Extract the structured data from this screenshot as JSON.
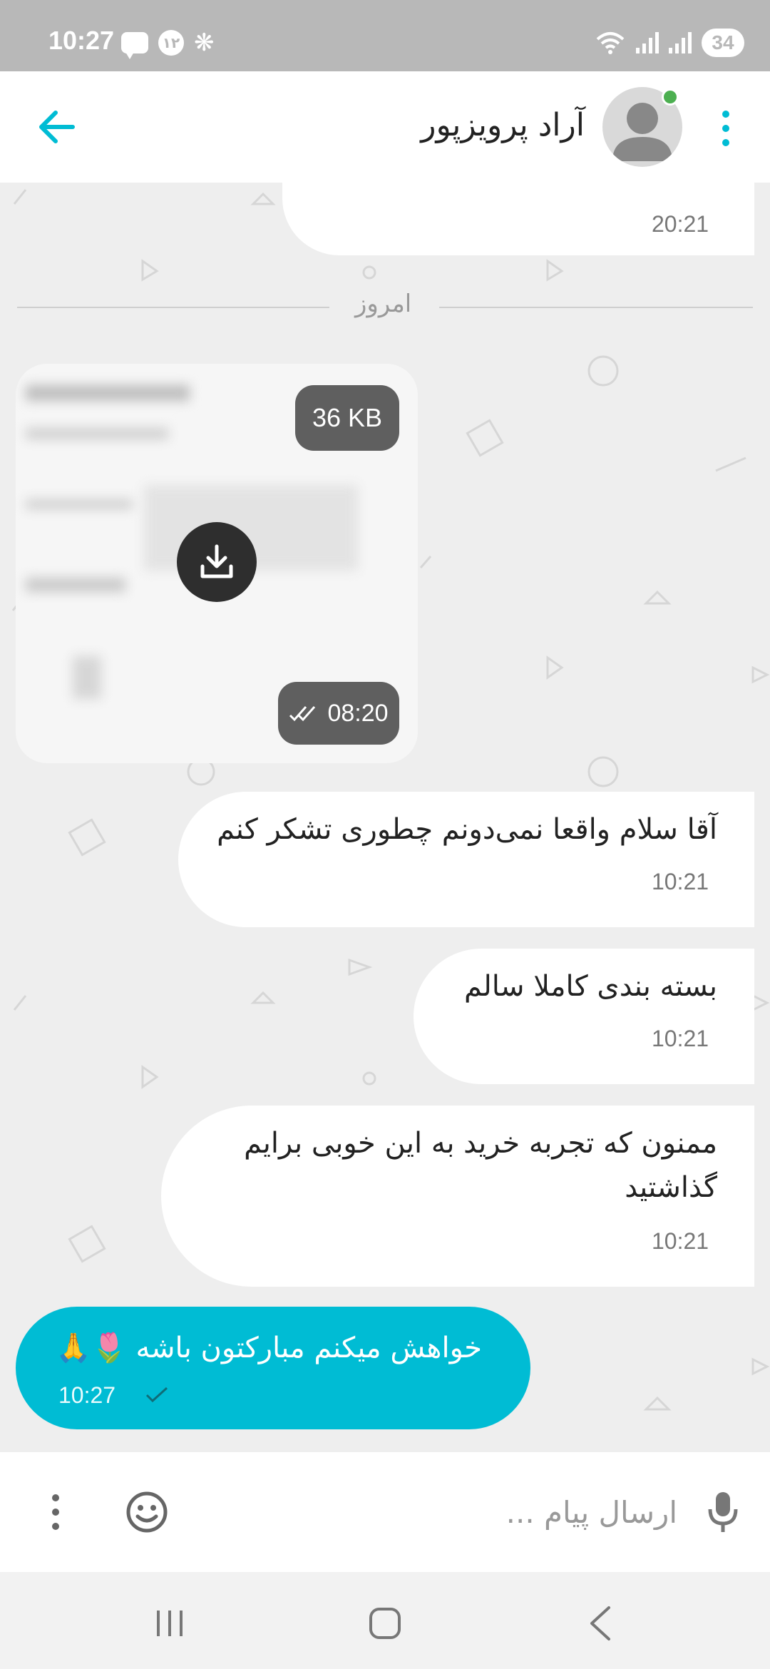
{
  "status_bar": {
    "time": "10:27",
    "notification_badge": "۱۲",
    "battery": "34"
  },
  "header": {
    "title": "آراد پرویزپور"
  },
  "messages": [
    {
      "text": "",
      "time": "20:21"
    },
    {
      "text": "آقا سلام واقعا نمی‌دونم چطوری تشکر کنم",
      "time": "10:21"
    },
    {
      "text": "بسته بندی کاملا سالم",
      "time": "10:21"
    },
    {
      "text": "ممنون که تجربه خرید به این خوبی برایم گذاشتید",
      "time": "10:21"
    }
  ],
  "date_divider": "امروز",
  "attachment": {
    "size": "36 KB",
    "time": "08:20"
  },
  "sent_message": {
    "text": "خواهش میکنم مبارکتون باشه 🌷🙏",
    "time": "10:27"
  },
  "composer": {
    "placeholder": "ارسال پیام ..."
  },
  "colors": {
    "accent": "#00bcd4",
    "online": "#4caf50",
    "background": "#eeeeee"
  }
}
